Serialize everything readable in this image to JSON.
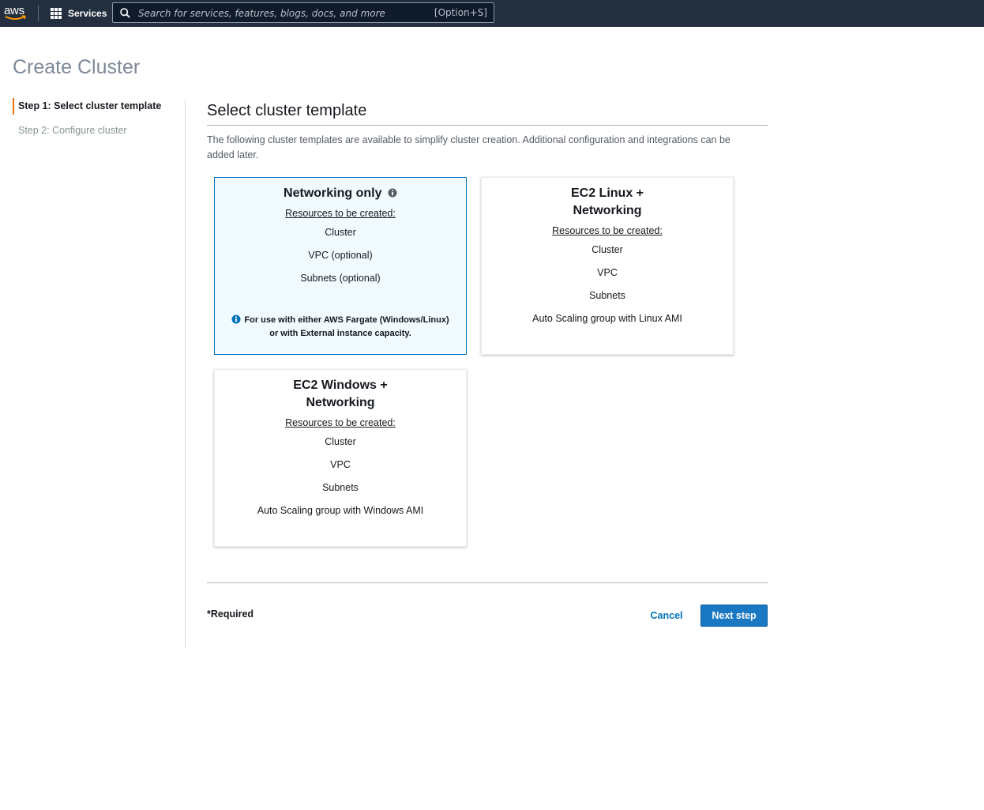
{
  "topnav": {
    "logo_text": "aws",
    "services_label": "Services",
    "search_placeholder": "Search for services, features, blogs, docs, and more",
    "search_shortcut": "[Option+S]"
  },
  "page": {
    "title": "Create Cluster"
  },
  "steps": [
    {
      "label": "Step 1: Select cluster template",
      "active": true
    },
    {
      "label": "Step 2: Configure cluster",
      "active": false
    }
  ],
  "section": {
    "title": "Select cluster template",
    "description": "The following cluster templates are available to simplify cluster creation. Additional configuration and integrations can be added later."
  },
  "templates": [
    {
      "title": "Networking only",
      "selected": true,
      "resources_label": "Resources to be created:",
      "items": [
        "Cluster",
        "VPC (optional)",
        "Subnets (optional)"
      ],
      "note": "For use with either AWS Fargate (Windows/Linux) or with External instance capacity."
    },
    {
      "title_line1": "EC2 Linux +",
      "title_line2": "Networking",
      "selected": false,
      "resources_label": "Resources to be created:",
      "items": [
        "Cluster",
        "VPC",
        "Subnets",
        "Auto Scaling group with Linux AMI"
      ]
    },
    {
      "title_line1": "EC2 Windows +",
      "title_line2": "Networking",
      "selected": false,
      "resources_label": "Resources to be created:",
      "items": [
        "Cluster",
        "VPC",
        "Subnets",
        "Auto Scaling group with Windows AMI"
      ]
    }
  ],
  "footer": {
    "required_label": "*Required",
    "cancel_label": "Cancel",
    "next_label": "Next step"
  },
  "colors": {
    "nav_bg": "#232f3e",
    "accent_orange": "#ec7211",
    "primary_blue": "#0073bb",
    "selected_card_bg": "#f1faff"
  }
}
